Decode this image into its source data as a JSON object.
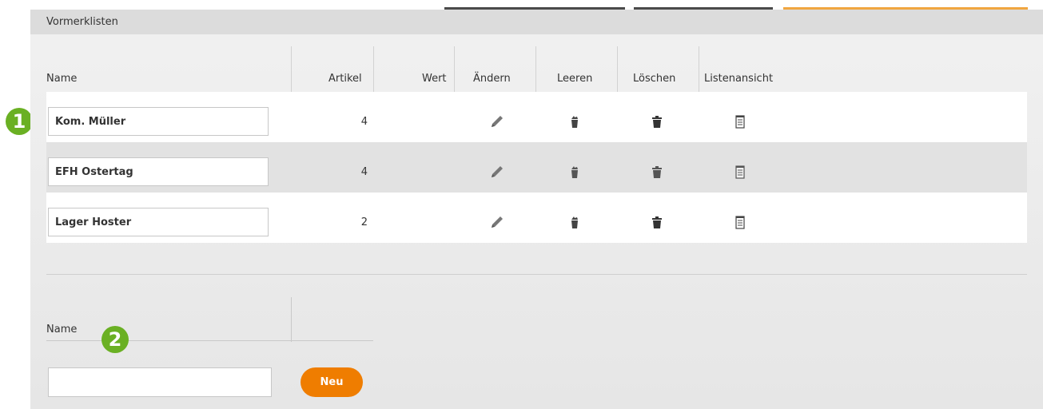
{
  "panel": {
    "title": "Vormerklisten"
  },
  "table": {
    "headers": {
      "name": "Name",
      "artikel": "Artikel",
      "wert": "Wert",
      "aendern": "Ändern",
      "leeren": "Leeren",
      "loeschen": "Löschen",
      "listenansicht": "Listenansicht"
    },
    "rows": [
      {
        "name": "Kom. Müller",
        "artikel": "4"
      },
      {
        "name": "EFH Ostertag",
        "artikel": "4"
      },
      {
        "name": "Lager Hoster",
        "artikel": "2"
      }
    ]
  },
  "new_list": {
    "label": "Name",
    "input_value": "",
    "button_label": "Neu"
  },
  "callouts": [
    "1",
    "2"
  ],
  "icons": {
    "edit": "pencil-icon",
    "clear": "clear-list-icon",
    "delete": "trash-icon",
    "view": "notepad-icon"
  },
  "colors": {
    "accent": "#ef7d00",
    "badge": "#6ab023",
    "panel": "#ebebeb",
    "row_alt": "#e2e2e2"
  }
}
